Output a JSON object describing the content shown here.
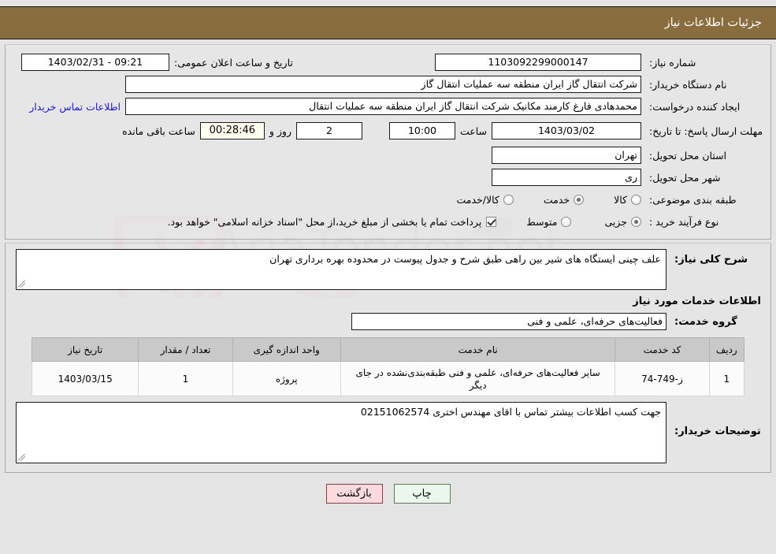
{
  "header": {
    "title": "جزئیات اطلاعات نیاز",
    "bg_color": "#8a6d3f",
    "text_color": "#ffffff"
  },
  "need_info": {
    "need_number_label": "شماره نیاز:",
    "need_number_value": "1103092299000147",
    "announce_label": "تاریخ و ساعت اعلان عمومی:",
    "announce_value": "09:21 - 1403/02/31",
    "buyer_org_label": "نام دستگاه خریدار:",
    "buyer_org_value": "شرکت انتقال گاز ایران منطقه سه عملیات انتقال گاز",
    "requester_label": "ایجاد کننده درخواست:",
    "requester_value": "محمدهادی فارغ کارمند مکانیک شرکت انتقال گاز ایران منطقه سه عملیات انتقال",
    "contact_link": "اطلاعات تماس خریدار",
    "deadline_label": "مهلت ارسال پاسخ: تا تاریخ:",
    "deadline_date": "1403/03/02",
    "deadline_hour_label": "ساعت",
    "deadline_hour": "10:00",
    "remaining_days": "2",
    "remaining_days_label": "روز و",
    "remaining_timer": "00:28:46",
    "remaining_timer_label": "ساعت باقی مانده",
    "timer_bg_color": "#fffff0",
    "province_label": "استان محل تحویل:",
    "province_value": "تهران",
    "city_label": "شهر محل تحویل:",
    "city_value": "ری",
    "category_label": "طبقه بندی موضوعی:",
    "category_options": [
      {
        "label": "کالا",
        "selected": false
      },
      {
        "label": "خدمت",
        "selected": true
      },
      {
        "label": "کالا/خدمت",
        "selected": false
      }
    ],
    "process_label": "نوع فرآیند خرید :",
    "process_options": [
      {
        "label": "جزیی",
        "selected": true
      },
      {
        "label": "متوسط",
        "selected": false
      }
    ],
    "treasury_checkbox_checked": true,
    "treasury_note": "پرداخت تمام یا بخشی از مبلغ خرید،از محل \"اسناد خزانه اسلامی\" خواهد بود."
  },
  "description": {
    "label": "شرح کلی نیاز:",
    "value": "علف چینی ایستگاه های شیر بین راهی  طبق شرح و جدول پیوست در محدوده بهره برداری تهران"
  },
  "services": {
    "section_title": "اطلاعات خدمات مورد نیاز",
    "group_label": "گروه خدمت:",
    "group_value": "فعالیت‌های حرفه‌ای، علمی و فنی",
    "columns": [
      "ردیف",
      "کد خدمت",
      "نام خدمت",
      "واحد اندازه گیری",
      "تعداد / مقدار",
      "تاریخ نیاز"
    ],
    "rows": [
      {
        "index": "1",
        "code": "ز-749-74",
        "name": "سایر فعالیت‌های حرفه‌ای، علمی و فنی طبقه‌بندی‌نشده در جای دیگر",
        "unit": "پروژه",
        "quantity": "1",
        "date": "1403/03/15"
      }
    ]
  },
  "buyer_notes": {
    "label": "توضیحات خریدار:",
    "value": "جهت کسب اطلاعات بیشتر تماس با اقای مهندس اختری 02151062574"
  },
  "footer": {
    "print_label": "چاپ",
    "back_label": "بازگشت",
    "print_bg": "#eaf7ea",
    "back_bg": "#fadadd"
  },
  "watermark": {
    "text": "AriaTender.net"
  }
}
